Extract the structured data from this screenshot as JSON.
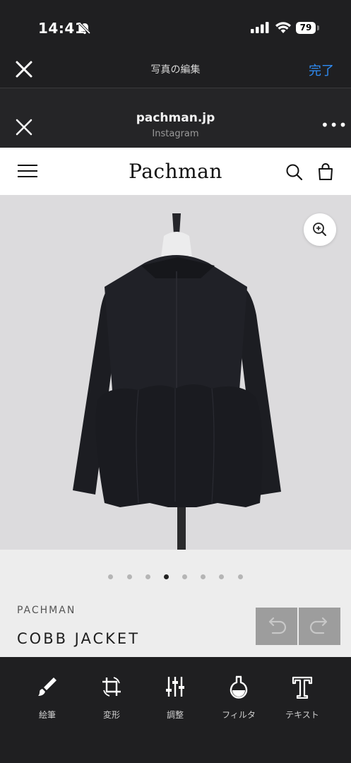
{
  "status_bar": {
    "time": "14:41",
    "battery": "79"
  },
  "edit_header": {
    "title": "写真の編集",
    "done_label": "完了"
  },
  "web_header": {
    "domain": "pachman.jp",
    "source": "Instagram",
    "more_label": "•••"
  },
  "site": {
    "logo": "Pachman"
  },
  "carousel": {
    "count": 8,
    "active_index": 3
  },
  "product": {
    "brand": "PACHMAN",
    "name": "COBB JACKET"
  },
  "toolbar": {
    "items": [
      {
        "label": "絵筆",
        "icon": "brush-icon"
      },
      {
        "label": "変形",
        "icon": "crop-rotate-icon"
      },
      {
        "label": "調整",
        "icon": "sliders-icon"
      },
      {
        "label": "フィルタ",
        "icon": "filter-flask-icon"
      },
      {
        "label": "テキスト",
        "icon": "text-icon"
      }
    ]
  },
  "colors": {
    "accent": "#2f8cf5",
    "dark_bg": "#1f1f21",
    "photo_bg": "#dcdbdd",
    "jacket": "#1c1d22"
  }
}
